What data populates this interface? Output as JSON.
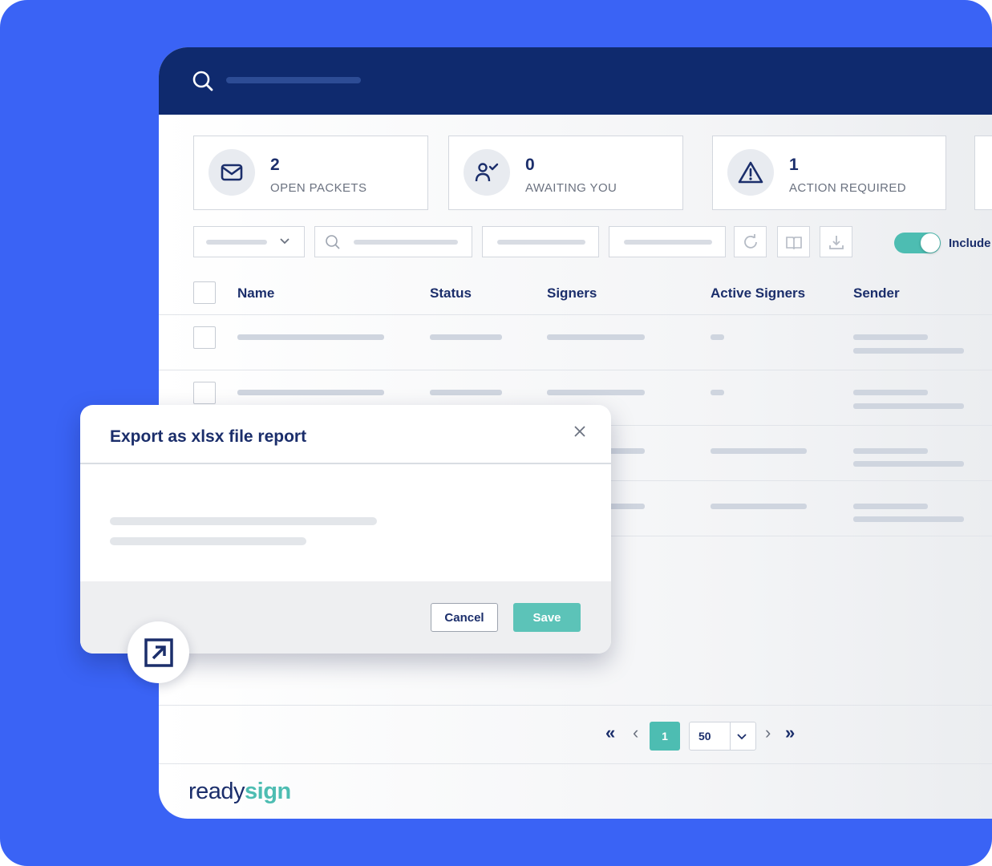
{
  "stats": [
    {
      "count": "2",
      "label": "OPEN PACKETS",
      "icon": "envelope-icon"
    },
    {
      "count": "0",
      "label": "AWAITING YOU",
      "icon": "user-check-icon"
    },
    {
      "count": "1",
      "label": "ACTION REQUIRED",
      "icon": "warning-icon"
    }
  ],
  "toolbar": {
    "include_label": "Include"
  },
  "table": {
    "columns": [
      "Name",
      "Status",
      "Signers",
      "Active Signers",
      "Sender"
    ]
  },
  "pagination": {
    "current_page": "1",
    "page_size": "50",
    "first": "«",
    "prev": "‹",
    "next": "›",
    "last": "»"
  },
  "modal": {
    "title": "Export as xlsx file report",
    "cancel_label": "Cancel",
    "save_label": "Save"
  },
  "brand": {
    "part1": "ready",
    "part2": "sign"
  },
  "colors": {
    "background": "#3a63f5",
    "topbar": "#0f2a6e",
    "accent": "#4dbdb2",
    "text": "#1b2e6b"
  }
}
